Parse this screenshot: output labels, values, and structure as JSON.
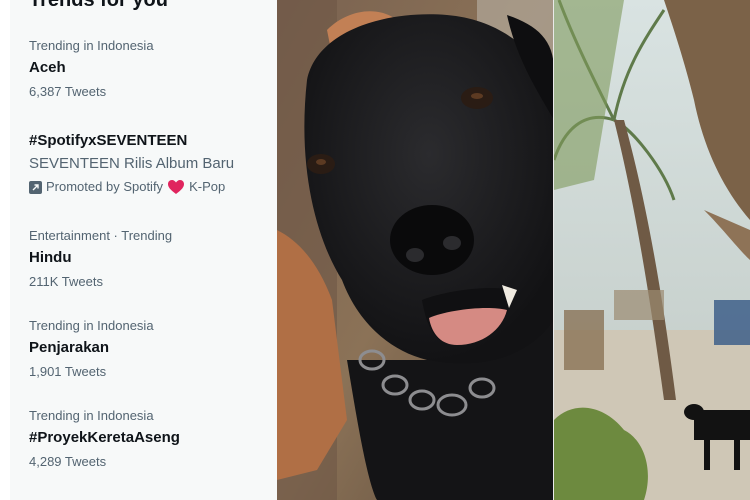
{
  "panel": {
    "title": "Trends for you"
  },
  "trends": [
    {
      "meta": "Trending in Indonesia",
      "name": "Aceh",
      "count": "6,387 Tweets"
    },
    {
      "name": "#SpotifyxSEVENTEEN",
      "description": "SEVENTEEN Rilis Album Baru",
      "promoted": "Promoted by Spotify",
      "tag": "K-Pop"
    },
    {
      "meta": "Entertainment · Trending",
      "name": "Hindu",
      "count": "211K Tweets"
    },
    {
      "meta": "Trending in Indonesia",
      "name": "Penjarakan",
      "count": "1,901 Tweets"
    },
    {
      "meta": "Trending in Indonesia",
      "name": "#ProyekKeretaAseng",
      "count": "4,289 Tweets"
    }
  ],
  "icons": {
    "promoted": "promoted-icon",
    "heart": "heart-icon"
  },
  "colors": {
    "panel_bg": "#f7f9f9",
    "primary_text": "#0f1419",
    "secondary_text": "#536471",
    "heart": "#e0245e"
  }
}
